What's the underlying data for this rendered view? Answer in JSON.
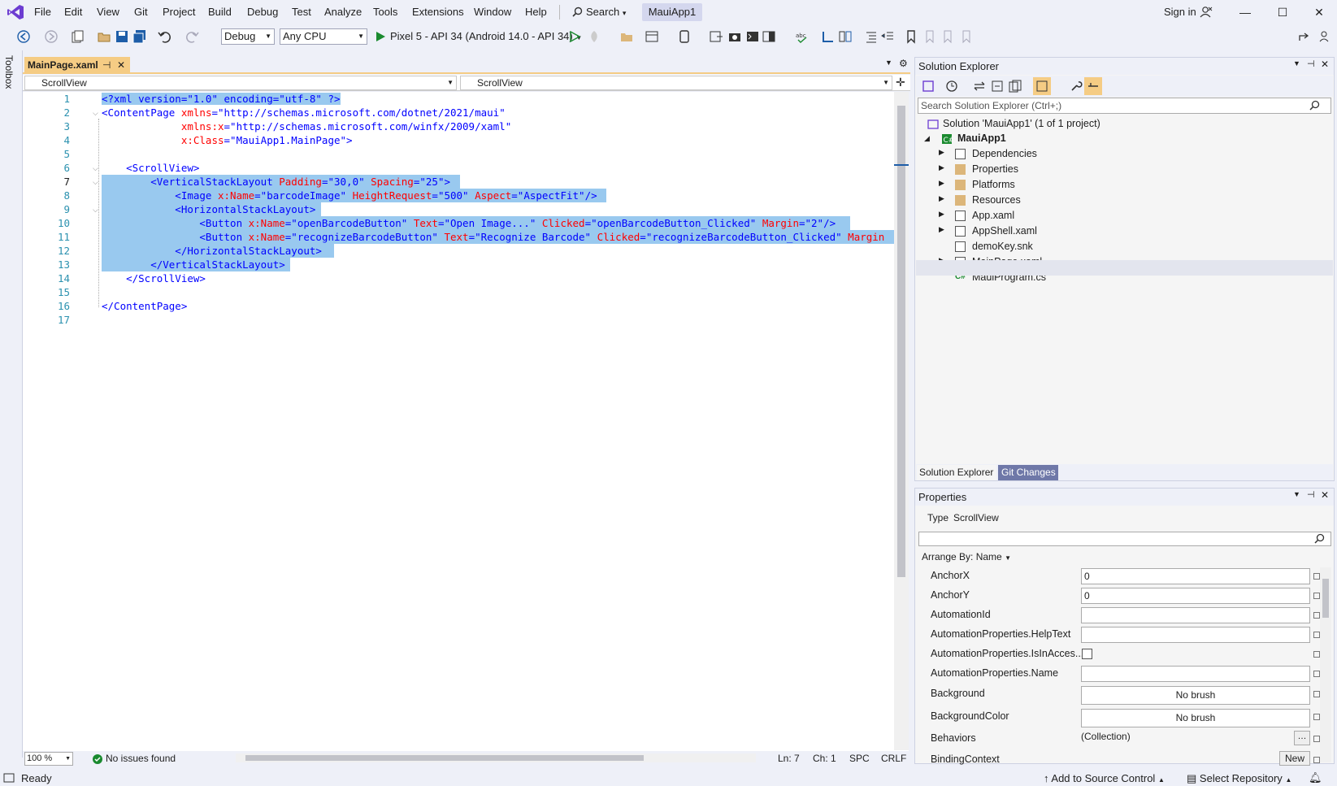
{
  "menu": [
    "File",
    "Edit",
    "View",
    "Git",
    "Project",
    "Build",
    "Debug",
    "Test",
    "Analyze",
    "Tools",
    "Extensions",
    "Window",
    "Help"
  ],
  "search_label": "Search",
  "app_title": "MauiApp1",
  "sign_in": "Sign in",
  "toolbar": {
    "config": "Debug",
    "platform": "Any CPU",
    "run_target": "Pixel 5 - API 34 (Android 14.0 - API 34)"
  },
  "toolbox_label": "Toolbox",
  "doc_tab": "MainPage.xaml",
  "nav": {
    "left": "ScrollView",
    "right": "ScrollView"
  },
  "code_lines": [
    "1",
    "2",
    "3",
    "4",
    "5",
    "6",
    "7",
    "8",
    "9",
    "10",
    "11",
    "12",
    "13",
    "14",
    "15",
    "16",
    "17"
  ],
  "code": {
    "l1": "<?xml version=\"1.0\" encoding=\"utf-8\" ?>",
    "l2a": "<ContentPage ",
    "l2b": "xmlns",
    "l2c": "=\"http://schemas.microsoft.com/dotnet/2021/maui\"",
    "l3a": "             xmlns:x",
    "l3b": "=\"http://schemas.microsoft.com/winfx/2009/xaml\"",
    "l4a": "             x:Class",
    "l4b": "=\"MauiApp1.MainPage\">",
    "l6": "    <ScrollView>",
    "l7a": "        <VerticalStackLayout ",
    "l7b": "Padding",
    "l7c": "=\"30,0\" ",
    "l7d": "Spacing",
    "l7e": "=\"25\">",
    "l8a": "            <Image ",
    "l8b": "x:Name",
    "l8c": "=\"barcodeImage\" ",
    "l8d": "HeightRequest",
    "l8e": "=\"500\" ",
    "l8f": "Aspect",
    "l8g": "=\"AspectFit\"/>",
    "l9": "            <HorizontalStackLayout>",
    "l10a": "                <Button ",
    "l10b": "x:Name",
    "l10c": "=\"openBarcodeButton\" ",
    "l10d": "Text",
    "l10e": "=\"Open Image...\" ",
    "l10f": "Clicked",
    "l10g": "=\"openBarcodeButton_Clicked\" ",
    "l10h": "Margin",
    "l10i": "=\"2\"/>",
    "l11a": "                <Button ",
    "l11b": "x:Name",
    "l11c": "=\"recognizeBarcodeButton\" ",
    "l11d": "Text",
    "l11e": "=\"Recognize Barcode\" ",
    "l11f": "Clicked",
    "l11g": "=\"recognizeBarcodeButton_Clicked\" ",
    "l11h": "Margin",
    "l12": "            </HorizontalStackLayout>",
    "l13": "        </VerticalStackLayout>",
    "l14": "    </ScrollView>",
    "l16": "</ContentPage>"
  },
  "editor_status": {
    "zoom": "100 %",
    "issues": "No issues found",
    "ln": "Ln: 7",
    "ch": "Ch: 1",
    "spc": "SPC",
    "crlf": "CRLF"
  },
  "solution_explorer": {
    "title": "Solution Explorer",
    "search_placeholder": "Search Solution Explorer (Ctrl+;)",
    "solution": "Solution 'MauiApp1' (1 of 1 project)",
    "project": "MauiApp1",
    "items": [
      "Dependencies",
      "Properties",
      "Platforms",
      "Resources",
      "App.xaml",
      "AppShell.xaml",
      "demoKey.snk",
      "MainPage.xaml",
      "MauiProgram.cs"
    ],
    "tabs": [
      "Solution Explorer",
      "Git Changes"
    ]
  },
  "properties": {
    "title": "Properties",
    "type_label": "Type",
    "type_value": "ScrollView",
    "arrange": "Arrange By: Name",
    "rows": [
      {
        "name": "AnchorX",
        "value": "0"
      },
      {
        "name": "AnchorY",
        "value": "0"
      },
      {
        "name": "AutomationId",
        "value": ""
      },
      {
        "name": "AutomationProperties.HelpText",
        "value": ""
      },
      {
        "name": "AutomationProperties.IsInAcces...",
        "value": ""
      },
      {
        "name": "AutomationProperties.Name",
        "value": ""
      },
      {
        "name": "Background",
        "value": "No brush"
      },
      {
        "name": "BackgroundColor",
        "value": "No brush"
      },
      {
        "name": "Behaviors",
        "value": "(Collection)"
      },
      {
        "name": "BindingContext",
        "value": "New"
      }
    ]
  },
  "status": {
    "ready": "Ready",
    "source_control": "Add to Source Control",
    "repository": "Select Repository"
  }
}
